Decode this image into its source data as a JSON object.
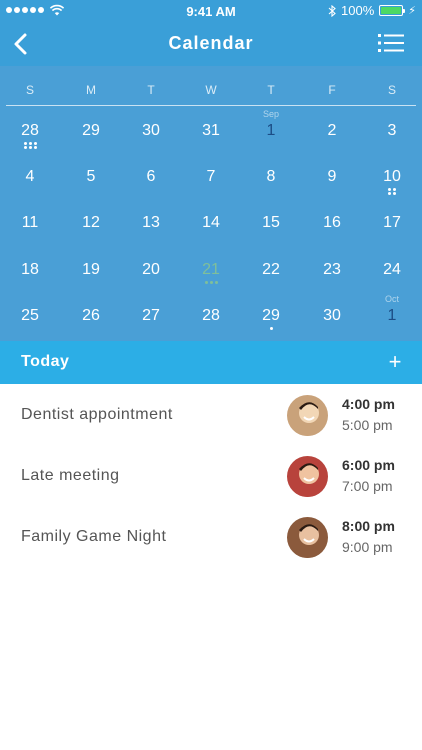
{
  "status_bar": {
    "time": "9:41 AM",
    "battery_pct": "100%",
    "battery_level": 1.0,
    "signal_dots": 5
  },
  "nav": {
    "title": "Calendar",
    "back_icon": "chevron-left-icon",
    "menu_icon": "list-icon"
  },
  "calendar": {
    "weekdays": [
      "S",
      "M",
      "T",
      "W",
      "T",
      "F",
      "S"
    ],
    "weeks": [
      [
        {
          "day": "28",
          "muted": false,
          "events": 6
        },
        {
          "day": "29",
          "muted": false,
          "events": 0
        },
        {
          "day": "30",
          "muted": false,
          "events": 0
        },
        {
          "day": "31",
          "muted": false,
          "events": 0
        },
        {
          "day": "1",
          "month": "Sep",
          "muted": true,
          "events": 0
        },
        {
          "day": "2",
          "muted": false,
          "events": 0
        },
        {
          "day": "3",
          "muted": false,
          "events": 0
        }
      ],
      [
        {
          "day": "4",
          "events": 0
        },
        {
          "day": "5",
          "events": 0
        },
        {
          "day": "6",
          "events": 0
        },
        {
          "day": "7",
          "events": 0
        },
        {
          "day": "8",
          "events": 0
        },
        {
          "day": "9",
          "events": 0
        },
        {
          "day": "10",
          "events": 4
        }
      ],
      [
        {
          "day": "11",
          "events": 0
        },
        {
          "day": "12",
          "events": 0
        },
        {
          "day": "13",
          "events": 0
        },
        {
          "day": "14",
          "events": 0
        },
        {
          "day": "15",
          "events": 0
        },
        {
          "day": "16",
          "events": 0
        },
        {
          "day": "17",
          "events": 0
        }
      ],
      [
        {
          "day": "18",
          "events": 0
        },
        {
          "day": "19",
          "events": 0
        },
        {
          "day": "20",
          "events": 0
        },
        {
          "day": "21",
          "today": true,
          "events": 3
        },
        {
          "day": "22",
          "events": 0
        },
        {
          "day": "23",
          "events": 0
        },
        {
          "day": "24",
          "events": 0
        }
      ],
      [
        {
          "day": "25",
          "events": 0
        },
        {
          "day": "26",
          "events": 0
        },
        {
          "day": "27",
          "events": 0
        },
        {
          "day": "28",
          "events": 0
        },
        {
          "day": "29",
          "events": 1
        },
        {
          "day": "30",
          "events": 0
        },
        {
          "day": "1",
          "month": "Oct",
          "muted": true,
          "events": 0
        }
      ]
    ]
  },
  "today_bar": {
    "label": "Today",
    "add_icon": "plus-icon"
  },
  "events": [
    {
      "title": "Dentist appointment",
      "start": "4:00 pm",
      "end": "5:00 pm",
      "avatar_colors": [
        "#c9a27a",
        "#f2d7b6"
      ]
    },
    {
      "title": "Late meeting",
      "start": "6:00 pm",
      "end": "7:00 pm",
      "avatar_colors": [
        "#b8433c",
        "#f0c3a0"
      ]
    },
    {
      "title": "Family Game Night",
      "start": "8:00 pm",
      "end": "9:00 pm",
      "avatar_colors": [
        "#8b5a3c",
        "#e8c0a0"
      ]
    }
  ],
  "colors": {
    "header": "#3a9fd8",
    "calendar_bg": "#4a9fd6",
    "today_bar": "#2caee6",
    "muted_day": "#1c4d86",
    "today_day": "#7fbf9a"
  }
}
